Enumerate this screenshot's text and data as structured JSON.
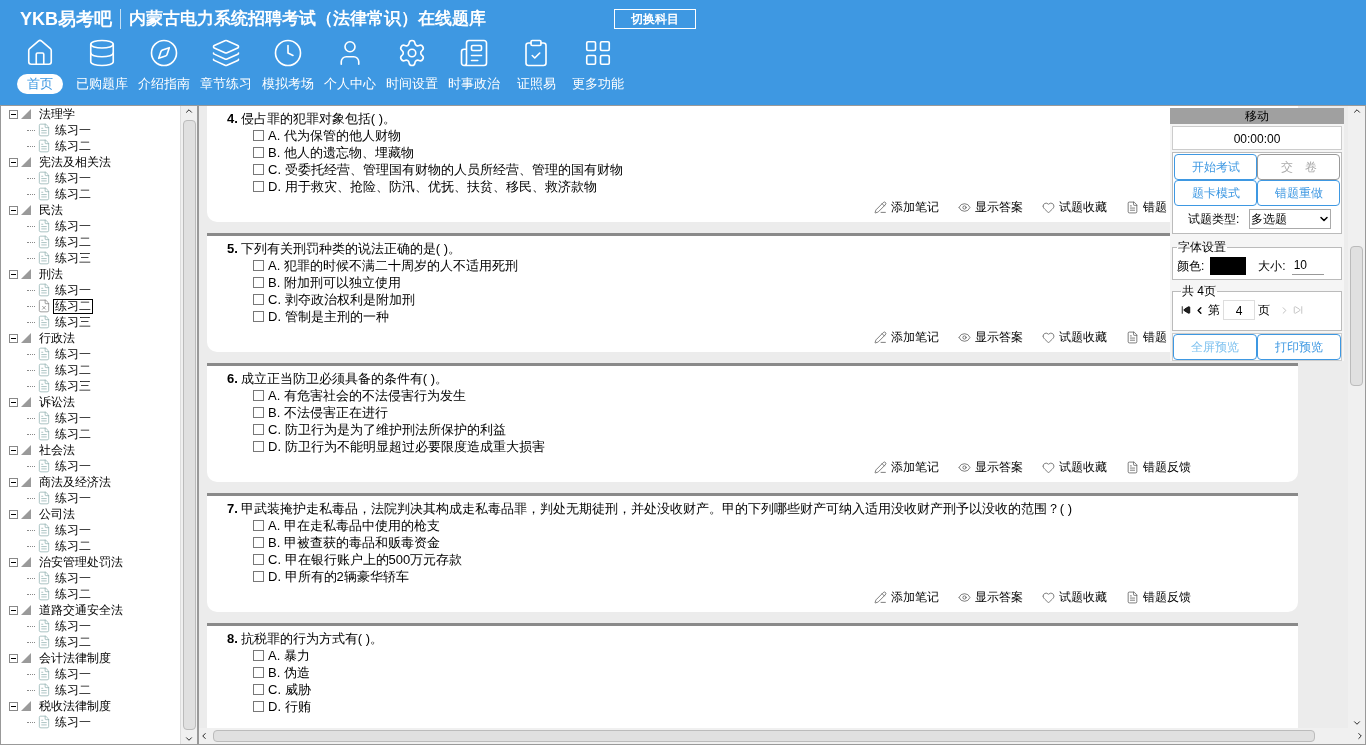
{
  "header": {
    "logo": "YKB易考吧",
    "title": "内蒙古电力系统招聘考试（法律常识）在线题库",
    "switch_button": "切换科目"
  },
  "nav": [
    {
      "label": "首页",
      "selected": true
    },
    {
      "label": "已购题库",
      "selected": false
    },
    {
      "label": "介绍指南",
      "selected": false
    },
    {
      "label": "章节练习",
      "selected": false
    },
    {
      "label": "模拟考场",
      "selected": false
    },
    {
      "label": "个人中心",
      "selected": false
    },
    {
      "label": "时间设置",
      "selected": false
    },
    {
      "label": "时事政治",
      "selected": false
    },
    {
      "label": "证照易",
      "selected": false
    },
    {
      "label": "更多功能",
      "selected": false
    }
  ],
  "tree": [
    {
      "label": "法理学",
      "children": [
        {
          "label": "练习一",
          "selected": false
        },
        {
          "label": "练习二",
          "selected": false
        }
      ]
    },
    {
      "label": "宪法及相关法",
      "children": [
        {
          "label": "练习一",
          "selected": false
        },
        {
          "label": "练习二",
          "selected": false
        }
      ]
    },
    {
      "label": "民法",
      "children": [
        {
          "label": "练习一",
          "selected": false
        },
        {
          "label": "练习二",
          "selected": false
        },
        {
          "label": "练习三",
          "selected": false
        }
      ]
    },
    {
      "label": "刑法",
      "children": [
        {
          "label": "练习一",
          "selected": false
        },
        {
          "label": "练习二",
          "selected": true
        },
        {
          "label": "练习三",
          "selected": false
        }
      ]
    },
    {
      "label": "行政法",
      "children": [
        {
          "label": "练习一",
          "selected": false
        },
        {
          "label": "练习二",
          "selected": false
        },
        {
          "label": "练习三",
          "selected": false
        }
      ]
    },
    {
      "label": "诉讼法",
      "children": [
        {
          "label": "练习一",
          "selected": false
        },
        {
          "label": "练习二",
          "selected": false
        }
      ]
    },
    {
      "label": "社会法",
      "children": [
        {
          "label": "练习一",
          "selected": false
        }
      ]
    },
    {
      "label": "商法及经济法",
      "children": [
        {
          "label": "练习一",
          "selected": false
        }
      ]
    },
    {
      "label": "公司法",
      "children": [
        {
          "label": "练习一",
          "selected": false
        },
        {
          "label": "练习二",
          "selected": false
        }
      ]
    },
    {
      "label": "治安管理处罚法",
      "children": [
        {
          "label": "练习一",
          "selected": false
        },
        {
          "label": "练习二",
          "selected": false
        }
      ]
    },
    {
      "label": "道路交通安全法",
      "children": [
        {
          "label": "练习一",
          "selected": false
        },
        {
          "label": "练习二",
          "selected": false
        }
      ]
    },
    {
      "label": "会计法律制度",
      "children": [
        {
          "label": "练习一",
          "selected": false
        },
        {
          "label": "练习二",
          "selected": false
        }
      ]
    },
    {
      "label": "税收法律制度",
      "children": [
        {
          "label": "练习一",
          "selected": false
        }
      ]
    }
  ],
  "questions": [
    {
      "number": "4.",
      "text": "侵占罪的犯罪对象包括( )。",
      "options": [
        {
          "text": "A. 代为保管的他人财物",
          "checked": false
        },
        {
          "text": "B. 他人的遗忘物、埋藏物",
          "checked": false
        },
        {
          "text": "C. 受委托经营、管理国有财物的人员所经营、管理的国有财物",
          "checked": false
        },
        {
          "text": "D. 用于救灾、抢险、防汛、优抚、扶贫、移民、救济款物",
          "checked": false
        }
      ],
      "actions": [
        "添加笔记",
        "显示答案",
        "试题收藏",
        "错题"
      ]
    },
    {
      "number": "5.",
      "text": "下列有关刑罚种类的说法正确的是( )。",
      "options": [
        {
          "text": "A. 犯罪的时候不满二十周岁的人不适用死刑",
          "checked": false
        },
        {
          "text": "B. 附加刑可以独立使用",
          "checked": false
        },
        {
          "text": "C. 剥夺政治权利是附加刑",
          "checked": false
        },
        {
          "text": "D. 管制是主刑的一种",
          "checked": false
        }
      ],
      "actions": [
        "添加笔记",
        "显示答案",
        "试题收藏",
        "错题"
      ]
    },
    {
      "number": "6.",
      "text": "成立正当防卫必须具备的条件有( )。",
      "options": [
        {
          "text": "A. 有危害社会的不法侵害行为发生",
          "checked": false
        },
        {
          "text": "B. 不法侵害正在进行",
          "checked": false
        },
        {
          "text": "C. 防卫行为是为了维护刑法所保护的利益",
          "checked": false
        },
        {
          "text": "D. 防卫行为不能明显超过必要限度造成重大损害",
          "checked": false
        }
      ],
      "actions": [
        "添加笔记",
        "显示答案",
        "试题收藏",
        "错题反馈"
      ]
    },
    {
      "number": "7.",
      "text": "甲武装掩护走私毒品，法院判决其构成走私毒品罪，判处无期徒刑，并处没收财产。甲的下列哪些财产可纳入适用没收财产刑予以没收的范围？( )",
      "options": [
        {
          "text": "A. 甲在走私毒品中使用的枪支",
          "checked": false
        },
        {
          "text": "B. 甲被查获的毒品和贩毒资金",
          "checked": false
        },
        {
          "text": "C. 甲在银行账户上的500万元存款",
          "checked": false
        },
        {
          "text": "D. 甲所有的2辆豪华轿车",
          "checked": false
        }
      ],
      "actions": [
        "添加笔记",
        "显示答案",
        "试题收藏",
        "错题反馈"
      ]
    },
    {
      "number": "8.",
      "text": "抗税罪的行为方式有( )。",
      "options": [
        {
          "text": "A. 暴力",
          "checked": false
        },
        {
          "text": "B. 伪造",
          "checked": false
        },
        {
          "text": "C. 威胁",
          "checked": false
        },
        {
          "text": "D. 行贿",
          "checked": false
        }
      ]
    }
  ],
  "panel": {
    "title": "移动",
    "timer": "00:00:00",
    "buttons": [
      {
        "label": "开始考试",
        "disabled": false
      },
      {
        "label": "交　卷",
        "disabled": true
      },
      {
        "label": "题卡模式",
        "disabled": false
      },
      {
        "label": "错题重做",
        "disabled": false
      }
    ],
    "type_label": "试题类型:",
    "type_value": "多选题",
    "font_group": "字体设置",
    "color_label": "颜色:",
    "color": "#000000",
    "size_label": "大小:",
    "size_value": "10",
    "page_group": "共 4页",
    "page_prefix": "第",
    "page_value": "4",
    "page_suffix": "页",
    "bottom_buttons": [
      "全屏预览",
      "打印预览"
    ]
  }
}
